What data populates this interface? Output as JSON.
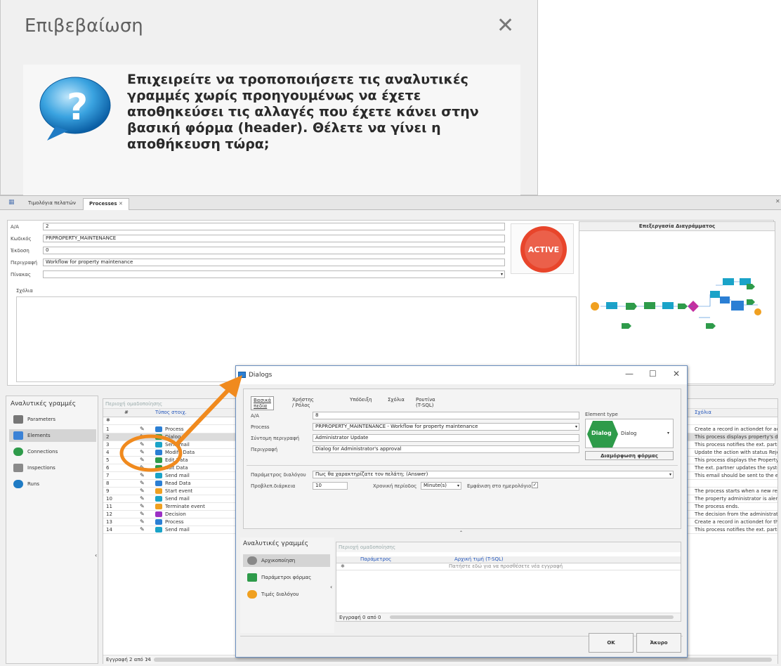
{
  "confirm": {
    "title": "Επιβεβαίωση",
    "message": "Επιχειρείτε να τροποποιήσετε τις αναλυτικές γραμμές χωρίς προηγουμένως να έχετε αποθηκεύσει τις αλλαγές που έχετε κάνει στην βασική φόρμα (header). Θέλετε να γίνει η αποθήκευση τώρα;",
    "close_label": "✕"
  },
  "tabs": [
    {
      "label": "Τιμολόγια πελατών"
    },
    {
      "label": "Processes"
    }
  ],
  "header": {
    "aa_label": "A/A",
    "aa_value": "2",
    "code_label": "Κωδικός",
    "code_value": "PRPROPERTY_MAINTENANCE",
    "version_label": "Έκδοση",
    "version_value": "0",
    "desc_label": "Περιγραφή",
    "desc_value": "Workflow for property maintenance",
    "table_label": "Πίνακας",
    "table_value": "",
    "comments_label": "Σχόλια",
    "status_badge": "ACTIVE"
  },
  "diagram": {
    "caption": "Επεξεργασία Διαγράμματος"
  },
  "sidebar": {
    "title": "Αναλυτικές γραμμές",
    "items": [
      {
        "label": "Parameters"
      },
      {
        "label": "Elements"
      },
      {
        "label": "Connections"
      },
      {
        "label": "Inspections"
      },
      {
        "label": "Runs"
      }
    ]
  },
  "grid": {
    "group_hint": "Περιοχή ομαδοποίησης",
    "col_hash": "#",
    "col_type": "Τύπος στοιχ.",
    "col_comments": "Σχόλια",
    "footer": "Εγγραφή 2 από 14",
    "rows": [
      {
        "n": "1",
        "type": "Process",
        "color": "#2b7fd4",
        "comment": "Create a record in actiondet for adr"
      },
      {
        "n": "2",
        "type": "Dialog",
        "color": "#2e9b4a",
        "comment": "This process displays property's data"
      },
      {
        "n": "3",
        "type": "Send mail",
        "color": "#1aa3c8",
        "comment": "This process notifies the ext. partne"
      },
      {
        "n": "4",
        "type": "Modify Data",
        "color": "#2b7fd4",
        "comment": "Update the action with status Rejec"
      },
      {
        "n": "5",
        "type": "Edit Data",
        "color": "#2e9b4a",
        "comment": "This process displays the Property d"
      },
      {
        "n": "6",
        "type": "Edit Data",
        "color": "#2e9b4a",
        "comment": "The ext. partner updates the syster"
      },
      {
        "n": "7",
        "type": "Send mail",
        "color": "#1aa3c8",
        "comment": "This email should be sent to the ema"
      },
      {
        "n": "8",
        "type": "Read Data",
        "color": "#2b7fd4",
        "comment": ""
      },
      {
        "n": "9",
        "type": "Start event",
        "color": "#f0a020",
        "comment": "The process starts when a new reco"
      },
      {
        "n": "10",
        "type": "Send mail",
        "color": "#1aa3c8",
        "comment": "The property administrator is alertec"
      },
      {
        "n": "11",
        "type": "Terminate event",
        "color": "#f0a020",
        "comment": "The process ends."
      },
      {
        "n": "12",
        "type": "Decision",
        "color": "#9b2fc4",
        "comment": "The decision from the administrator."
      },
      {
        "n": "13",
        "type": "Process",
        "color": "#2b7fd4",
        "comment": "Create a record in actiondet for the"
      },
      {
        "n": "14",
        "type": "Send mail",
        "color": "#1aa3c8",
        "comment": "This process notifies the ext. partne"
      }
    ]
  },
  "dialog": {
    "title": "Dialogs",
    "tabs": [
      "Βασικά πεδία",
      "Χρήστης / Ρόλος",
      "Υπόδειξη",
      "Σχόλια",
      "Ρουτίνα (T-SQL)"
    ],
    "aa_label": "A/A",
    "aa_value": "8",
    "process_label": "Process",
    "process_value": "PRPROPERTY_MAINTENANCE - Workflow for property maintenance",
    "short_label": "Σύντομη περιγραφή",
    "short_value": "Administrator Update",
    "desc_label": "Περιγραφή",
    "desc_value": "Dialog for Administrator's approval",
    "element_type_label": "Element type",
    "element_type_value": "Dialog",
    "element_badge": "Dialog",
    "form_btn": "Διαμόρφωση φόρμας",
    "param_label": "Παράμετρος διαλόγου",
    "param_value": "Πως θα χαρακτηρίζατε τον πελάτη; (Answer)",
    "duration_label": "Προβλεπ.διάρκεια",
    "duration_value": "10",
    "period_label": "Χρονική περίοδος",
    "period_value": "Minute(s)",
    "calendar_label": "Εμφάνιση στο ημερολόγιο",
    "sub_title": "Αναλυτικές γραμμές",
    "sub_items": [
      {
        "label": "Αρχικοποίηση"
      },
      {
        "label": "Παράμετροι φόρμας"
      },
      {
        "label": "Τιμές διαλόγου"
      }
    ],
    "sub_group_hint": "Περιοχή ομαδοποίησης",
    "sub_col_param": "Παράμετρος",
    "sub_col_init": "Αρχική τιμή (T-SQL)",
    "sub_new_row": "Πατήστε εδώ για να προσθέσετε νέα εγγραφή",
    "sub_footer": "Εγγραφή 0 από 0",
    "ok": "OK",
    "cancel": "Άκυρο"
  },
  "colors": {
    "accent": "#f08a1e",
    "active_badge": "#e8452b",
    "dialog_green": "#2e9b4a"
  }
}
